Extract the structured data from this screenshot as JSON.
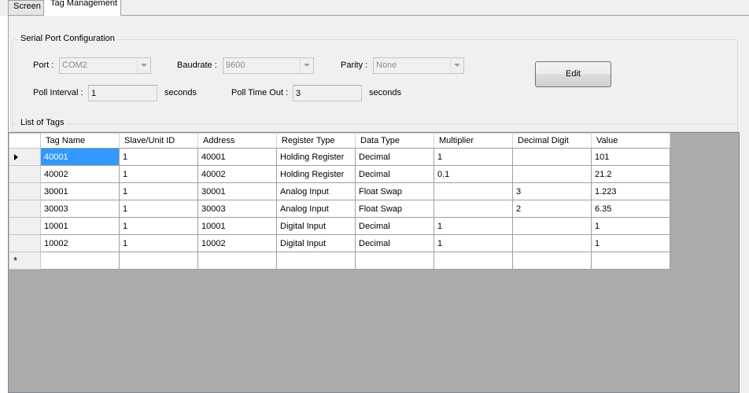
{
  "tabs": [
    {
      "label": "Screen",
      "active": false
    },
    {
      "label": "Tag Management",
      "active": true
    }
  ],
  "serial_config": {
    "title": "Serial Port Configuration",
    "port": {
      "label": "Port :",
      "value": "COM2"
    },
    "baudrate": {
      "label": "Baudrate :",
      "value": "9600"
    },
    "parity": {
      "label": "Parity :",
      "value": "None"
    },
    "poll_interval": {
      "label": "Poll Interval :",
      "value": "1",
      "unit": "seconds"
    },
    "poll_timeout": {
      "label": "Poll Time Out :",
      "value": "3",
      "unit": "seconds"
    },
    "edit_button": "Edit"
  },
  "tags": {
    "title": "List of Tags",
    "columns": [
      "Tag Name",
      "Slave/Unit ID",
      "Address",
      "Register Type",
      "Data Type",
      "Multiplier",
      "Decimal Digit",
      "Value"
    ],
    "rows": [
      [
        "40001",
        "1",
        "40001",
        "Holding Register",
        "Decimal",
        "1",
        "",
        "101"
      ],
      [
        "40002",
        "1",
        "40002",
        "Holding Register",
        "Decimal",
        "0.1",
        "",
        "21.2"
      ],
      [
        "30001",
        "1",
        "30001",
        "Analog Input",
        "Float Swap",
        "",
        "3",
        "1.223"
      ],
      [
        "30003",
        "1",
        "30003",
        "Analog Input",
        "Float Swap",
        "",
        "2",
        "6.35"
      ],
      [
        "10001",
        "1",
        "10001",
        "Digital Input",
        "Decimal",
        "1",
        "",
        "1"
      ],
      [
        "10002",
        "1",
        "10002",
        "Digital Input",
        "Decimal",
        "1",
        "",
        "1"
      ]
    ],
    "new_row_marker": "*"
  },
  "colors": {
    "selection": "#3399ff",
    "grid_background": "#ababab"
  }
}
